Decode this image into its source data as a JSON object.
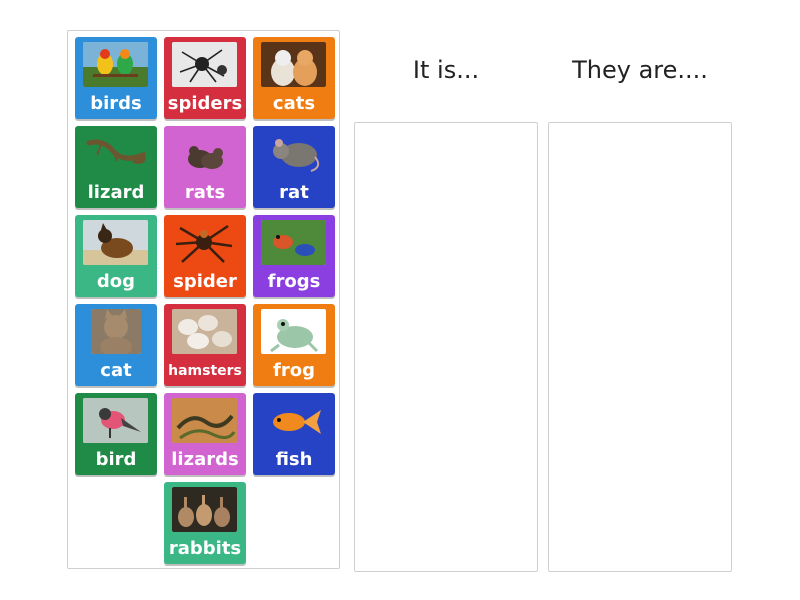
{
  "columns": [
    {
      "heading": "It is..."
    },
    {
      "heading": "They are...."
    }
  ],
  "cards": [
    {
      "label": "birds",
      "color": "#2d8fd9",
      "icon": "birds-photo"
    },
    {
      "label": "spiders",
      "color": "#d52e3f",
      "icon": "spiders-photo"
    },
    {
      "label": "cats",
      "color": "#ef7d12",
      "icon": "cats-photo"
    },
    {
      "label": "lizard",
      "color": "#1f8b47",
      "icon": "lizard-photo"
    },
    {
      "label": "rats",
      "color": "#d164d0",
      "icon": "rats-photo"
    },
    {
      "label": "rat",
      "color": "#2543c4",
      "icon": "rat-photo"
    },
    {
      "label": "dog",
      "color": "#3bb786",
      "icon": "dog-photo"
    },
    {
      "label": "spider",
      "color": "#ec4a12",
      "icon": "spider-photo"
    },
    {
      "label": "frogs",
      "color": "#8c3fe0",
      "icon": "frogs-photo"
    },
    {
      "label": "cat",
      "color": "#2d8fd9",
      "icon": "cat-photo"
    },
    {
      "label": "hamsters",
      "color": "#d52e3f",
      "icon": "hamsters-photo"
    },
    {
      "label": "frog",
      "color": "#ef7d12",
      "icon": "frog-photo"
    },
    {
      "label": "bird",
      "color": "#1f8b47",
      "icon": "bird-photo"
    },
    {
      "label": "lizards",
      "color": "#d164d0",
      "icon": "lizards-photo"
    },
    {
      "label": "fish",
      "color": "#2543c4",
      "icon": "fish-photo"
    },
    {
      "label": "rabbits",
      "color": "#3bb786",
      "icon": "rabbits-photo"
    }
  ]
}
